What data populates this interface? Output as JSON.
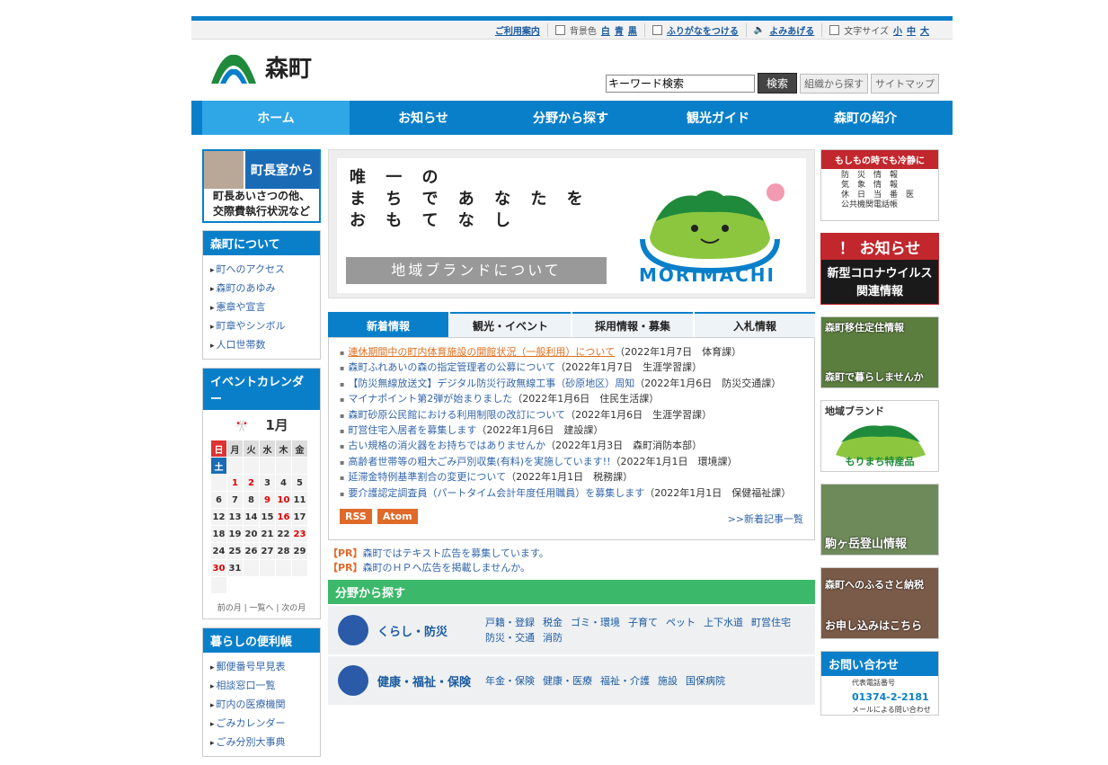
{
  "util": {
    "guide": "ご利用案内",
    "bg_label": "背景色",
    "bg_white": "白",
    "bg_blue": "青",
    "bg_black": "黒",
    "furigana": "ふりがなをつける",
    "readaloud": "よみあげる",
    "fontsize_label": "文字サイズ",
    "fs_small": "小",
    "fs_mid": "中",
    "fs_large": "大"
  },
  "header": {
    "logo_text": "森町",
    "search_value": "キーワード検索",
    "search_button": "検索",
    "org_search": "組織から探す",
    "sitemap": "サイトマップ"
  },
  "gnav": [
    "ホーム",
    "お知らせ",
    "分野から探す",
    "観光ガイド",
    "森町の紹介"
  ],
  "mayor": {
    "title": "町長室から",
    "desc1": "町長あいさつの他、",
    "desc2": "交際費執行状況など"
  },
  "about": {
    "title": "森町について",
    "items": [
      "町へのアクセス",
      "森町のあゆみ",
      "憲章や宣言",
      "町章やシンボル",
      "人口世帯数"
    ]
  },
  "calendar": {
    "title": "イベントカレンダー",
    "month": "1月",
    "weekdays": [
      "日",
      "月",
      "火",
      "水",
      "木",
      "金",
      "土"
    ],
    "weeks": [
      [
        "",
        "",
        "",
        "",
        "",
        "",
        ""
      ],
      [
        "",
        "1",
        "2",
        "3",
        "4",
        "5",
        ""
      ],
      [
        "6",
        "7",
        "8",
        "9",
        "10",
        "11",
        ""
      ],
      [
        "12",
        "13",
        "14",
        "15",
        "16",
        "17",
        ""
      ],
      [
        "18",
        "19",
        "20",
        "21",
        "22",
        "23",
        ""
      ],
      [
        "24",
        "25",
        "26",
        "27",
        "28",
        "29",
        ""
      ],
      [
        "30",
        "31",
        "",
        "",
        "",
        "",
        ""
      ]
    ],
    "nav": "前の月 | 一覧へ | 次の月"
  },
  "living": {
    "title": "暮らしの便利帳",
    "items": [
      "郵便番号早見表",
      "相談窓口一覧",
      "町内の医療機関",
      "ごみカレンダー",
      "ごみ分別大事典"
    ]
  },
  "banner": {
    "slogan1": "唯 一 の",
    "slogan2": "ま ち で あ な た を",
    "slogan3": "お も て な し",
    "brand": "地域ブランドについて",
    "mori": "MORIMACHI"
  },
  "tabs": [
    "新着情報",
    "観光・イベント",
    "採用情報・募集",
    "入札情報"
  ],
  "news": [
    {
      "text": "連休期間中の町内体育施設の開館状況（一般利用）について",
      "date": "（2022年1月7日　体育課）"
    },
    {
      "text": "森町ふれあいの森の指定管理者の公募について",
      "date": "（2022年1月7日　生涯学習課）"
    },
    {
      "text": "【防災無線放送文】デジタル防災行政無線工事（砂原地区）周知",
      "date": "（2022年1月6日　防災交通課）"
    },
    {
      "text": "マイナポイント第2弾が始まりました",
      "date": "（2022年1月6日　住民生活課）"
    },
    {
      "text": "森町砂原公民館における利用制限の改訂について",
      "date": "（2022年1月6日　生涯学習課）"
    },
    {
      "text": "町営住宅入居者を募集します",
      "date": "（2022年1月6日　建設課）"
    },
    {
      "text": "古い規格の消火器をお持ちではありませんか",
      "date": "（2022年1月3日　森町消防本部）"
    },
    {
      "text": "高齢者世帯等の粗大ごみ戸別収集(有料)を実施しています!!",
      "date": "（2022年1月1日　環境課）"
    },
    {
      "text": "延滞金特例基準割合の変更について",
      "date": "（2022年1月1日　税務課）"
    },
    {
      "text": "要介護認定調査員（パートタイム会計年度任用職員）を募集します",
      "date": "（2022年1月1日　保健福祉課）"
    }
  ],
  "feeds": {
    "rss": "RSS",
    "atom": "Atom",
    "more": ">>新着記事一覧"
  },
  "pr": [
    {
      "tag": "【PR】",
      "text": "森町ではテキスト広告を募集しています。"
    },
    {
      "tag": "【PR】",
      "text": "森町のＨＰへ広告を掲載しませんか。"
    }
  ],
  "fields": {
    "title": "分野から探す",
    "rows": [
      {
        "label": "くらし・防災",
        "links": [
          "戸籍・登録",
          "税金",
          "ゴミ・環境",
          "子育て",
          "ペット",
          "上下水道",
          "町営住宅",
          "防災・交通",
          "消防"
        ]
      },
      {
        "label": "健康・福祉・保険",
        "links": [
          "年金・保険",
          "健康・医療",
          "福祉・介護",
          "施設",
          "国保病院"
        ]
      }
    ]
  },
  "right": {
    "emergency_head": "もしもの時でも冷静に",
    "emergency_items": [
      "防　災　情　報",
      "気　象　情　報",
      "休　日　当　番　医",
      "公共機関電話帳"
    ],
    "covid_head": "！ お知らせ",
    "covid_body1": "新型コロナウイルス",
    "covid_body2": "関連情報",
    "move_top": "森町移住定住情報",
    "move_bottom": "森町で暮らしませんか",
    "brand_top": "地域ブランド",
    "brand_bottom": "もりまち特産品",
    "mountain": "駒ヶ岳登山情報",
    "furusato_top": "森町へのふるさと納税",
    "furusato_bottom": "お申し込みはこちら",
    "contact_title": "お問い合わせ",
    "tel_label": "代表電話番号",
    "tel": "01374-2-2181",
    "mail_label": "メールによる問い合わせ"
  },
  "colors": {
    "primary": "#0a7fc9",
    "active": "#2fa6e6",
    "green": "#3cb86a",
    "accent": "#e06a2a",
    "red": "#c1272d"
  }
}
